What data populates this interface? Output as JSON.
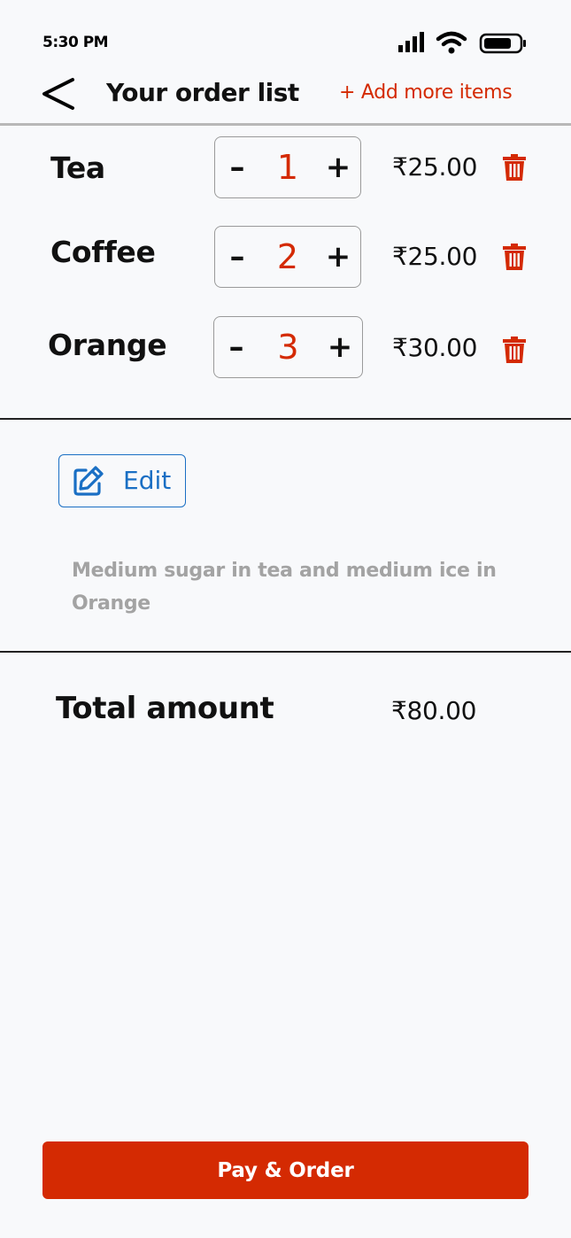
{
  "status_bar": {
    "time": "5:30 PM",
    "icons": [
      "signal-icon",
      "wifi-icon",
      "battery-icon"
    ]
  },
  "header": {
    "title": "Your order list",
    "add_more_label": "+ Add more items",
    "back_icon": "back-arrow-icon"
  },
  "items": [
    {
      "name": "Tea",
      "quantity": "1",
      "price": "₹25.00"
    },
    {
      "name": "Coffee",
      "quantity": "2",
      "price": "₹25.00"
    },
    {
      "name": "Orange",
      "quantity": "3",
      "price": "₹30.00"
    }
  ],
  "stepper": {
    "minus": "–",
    "plus": "+"
  },
  "edit": {
    "label": "Edit",
    "note": "Medium sugar in tea and medium ice in Orange"
  },
  "total": {
    "label": "Total amount",
    "value": "₹80.00"
  },
  "pay_button_label": "Pay & Order",
  "colors": {
    "accent": "#d42a02",
    "edit_blue": "#1a6fc4",
    "background": "#f8f9fb",
    "note_gray": "#a3a3a3"
  }
}
